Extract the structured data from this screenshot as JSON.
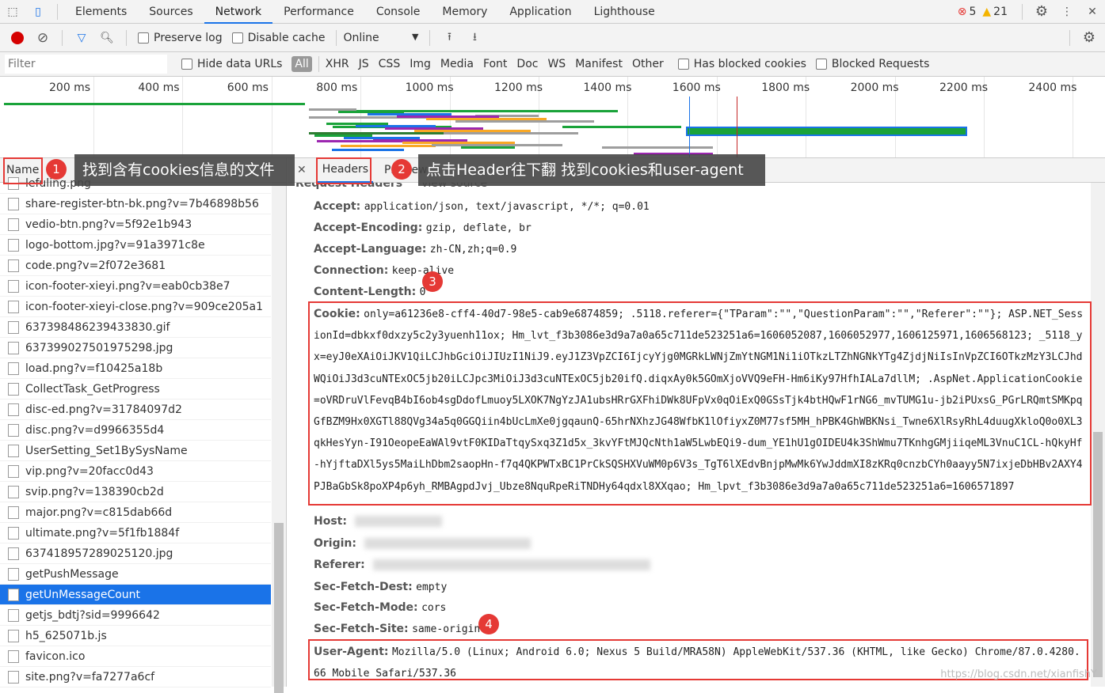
{
  "tabs": {
    "items": [
      "Elements",
      "Sources",
      "Network",
      "Performance",
      "Console",
      "Memory",
      "Application",
      "Lighthouse"
    ],
    "active": "Network",
    "errors": "5",
    "warnings": "21"
  },
  "toolbar": {
    "preserve_log": "Preserve log",
    "disable_cache": "Disable cache",
    "throttle": "Online"
  },
  "filters": {
    "placeholder": "Filter",
    "hide_data_urls": "Hide data URLs",
    "types": [
      "All",
      "XHR",
      "JS",
      "CSS",
      "Img",
      "Media",
      "Font",
      "Doc",
      "WS",
      "Manifest",
      "Other"
    ],
    "blocked_cookies": "Has blocked cookies",
    "blocked_requests": "Blocked Requests"
  },
  "timeline": {
    "ticks": [
      "200 ms",
      "400 ms",
      "600 ms",
      "800 ms",
      "1000 ms",
      "1200 ms",
      "1400 ms",
      "1600 ms",
      "1800 ms",
      "2000 ms",
      "2200 ms",
      "2400 ms"
    ]
  },
  "list": {
    "header": "Name",
    "items": [
      "lefuling.png",
      "share-register-btn-bk.png?v=7b46898b56",
      "vedio-btn.png?v=5f92e1b943",
      "logo-bottom.jpg?v=91a3971c8e",
      "code.png?v=2f072e3681",
      "icon-footer-xieyi.png?v=eab0cb38e7",
      "icon-footer-xieyi-close.png?v=909ce205a1",
      "637398486239433830.gif",
      "637399027501975298.jpg",
      "load.png?v=f10425a18b",
      "CollectTask_GetProgress",
      "disc-ed.png?v=31784097d2",
      "disc.png?v=d9966355d4",
      "UserSetting_Set1BySysName",
      "vip.png?v=20facc0d43",
      "svip.png?v=138390cb2d",
      "major.png?v=c815dab66d",
      "ultimate.png?v=5f1fb1884f",
      "637418957289025120.jpg",
      "getPushMessage",
      "getUnMessageCount",
      "getjs_bdtj?sid=9996642",
      "h5_625071b.js",
      "favicon.ico",
      "site.png?v=fa7277a6cf"
    ],
    "selected": "getUnMessageCount"
  },
  "detail": {
    "tabs": [
      "Headers",
      "Preview"
    ],
    "section": "Request Headers",
    "view_source": "view source",
    "headers": [
      {
        "k": "Accept:",
        "v": "application/json, text/javascript, */*; q=0.01"
      },
      {
        "k": "Accept-Encoding:",
        "v": "gzip, deflate, br"
      },
      {
        "k": "Accept-Language:",
        "v": "zh-CN,zh;q=0.9"
      },
      {
        "k": "Connection:",
        "v": "keep-alive"
      },
      {
        "k": "Content-Length:",
        "v": "0"
      }
    ],
    "cookie": {
      "k": "Cookie:",
      "v": "only=a61236e8-cff4-40d7-98e5-cab9e6874859; .5118.referer={\"TParam\":\"\",\"QuestionParam\":\"\",\"Referer\":\"\"}; ASP.NET_SessionId=dbkxf0dxzy5c2y3yuenh11ox; Hm_lvt_f3b3086e3d9a7a0a65c711de523251a6=1606052087,1606052977,1606125971,1606568123; _5118_yx=eyJ0eXAiOiJKV1QiLCJhbGciOiJIUzI1NiJ9.eyJ1Z3VpZCI6IjcyYjg0MGRkLWNjZmYtNGM1Ni1iOTkzLTZhNGNkYTg4ZjdjNiIsInVpZCI6OTkzMzY3LCJhdWQiOiJ3d3cuNTExOC5jb20iLCJpc3MiOiJ3d3cuNTExOC5jb20ifQ.diqxAy0k5GOmXjoVVQ9eFH-Hm6iKy97HfhIALa7dllM; .AspNet.ApplicationCookie=oVRDruVlFevqB4bI6ob4sgDdofLmuoy5LXOK7NgYzJA1ubsHRrGXFhiDWk8UFpVx0qOiExQ0GSsTjk4btHQwF1rNG6_mvTUMG1u-jb2iPUxsG_PGrLRQmtSMKpqGfBZM9Hx0XGTl88QVg34a5q0GGQiin4bUcLmXe0jgqaunQ-65hrNXhzJG48WfbK1lOfiyxZ0M77sf5MH_hPBK4GhWBKNsi_Twne6XlRsyRhL4duugXkloQ0o0XL3qkHesYyn-I91OeopeEaWAl9vtF0KIDaTtqySxq3Z1d5x_3kvYFtMJQcNth1aW5LwbEQi9-dum_YE1hU1gOIDEU4k3ShWmu7TKnhgGMjiiqeML3VnuC1CL-hQkyHf-hYjftaDXl5ys5MaiLhDbm2saopHn-f7q4QKPWTxBC1PrCkSQSHXVuWM0p6V3s_TgT6lXEdvBnjpMwMk6YwJddmXI8zKRq0cnzbCYh0aayy5N7ixjeDbHBv2AXY4PJBaGbSk8poXP4p6yh_RMBAgpdJvj_Ubze8NquRpeRiTNDHy64qdxl8XXqao; Hm_lpvt_f3b3086e3d9a7a0a65c711de523251a6=1606571897"
    },
    "blurred": [
      {
        "k": "Host:"
      },
      {
        "k": "Origin:"
      },
      {
        "k": "Referer:"
      }
    ],
    "headers2": [
      {
        "k": "Sec-Fetch-Dest:",
        "v": "empty"
      },
      {
        "k": "Sec-Fetch-Mode:",
        "v": "cors"
      },
      {
        "k": "Sec-Fetch-Site:",
        "v": "same-origin"
      }
    ],
    "ua": {
      "k": "User-Agent:",
      "v": "Mozilla/5.0 (Linux; Android 6.0; Nexus 5 Build/MRA58N) AppleWebKit/537.36 (KHTML, like Gecko) Chrome/87.0.4280.66 Mobile Safari/537.36"
    }
  },
  "annotations": {
    "n1": "1",
    "t1": "找到含有cookies信息的文件",
    "n2": "2",
    "t2": "点击Header往下翻 找到cookies和user-agent",
    "n3": "3",
    "n4": "4"
  },
  "watermark": "https://blog.csdn.net/xianfishY",
  "colors": {
    "accent": "#1a73e8",
    "annotation": "#e53935",
    "record": "#d50000"
  }
}
